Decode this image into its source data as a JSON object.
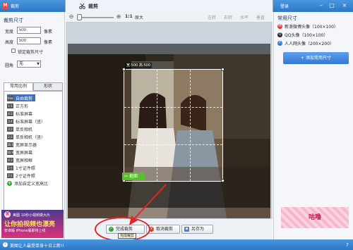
{
  "window": {
    "app_title": "裁剪",
    "tab_title": "裁剪",
    "login": "登录"
  },
  "left": {
    "section_title": "裁剪尺寸",
    "width_label": "宽度",
    "width_value": "500",
    "width_unit": "像素",
    "height_label": "高度",
    "height_value": "500",
    "height_unit": "像素",
    "lock_label": "锁定裁剪尺寸",
    "corner_label": "圆角",
    "corner_value": "无",
    "tab_common": "常用比例",
    "tab_shape": "形状",
    "ratios": [
      "自由裁剪",
      "正方形",
      "标准屏幕",
      "标准屏幕（竖）",
      "单反相机",
      "单反相机（竖）",
      "宽屏显示器",
      "宽屏屏幕",
      "宽屏相框",
      "1寸证件照",
      "2寸证件照",
      "添加自定义宽高比"
    ],
    "ratio_icons": [
      "free",
      "1:1",
      "4:3",
      "3:4",
      "3:2",
      "2:3",
      "16:10",
      "16:9",
      "4:3",
      "1寸",
      "2寸",
      "+"
    ]
  },
  "ad": {
    "line1": "美图 10秒小视频做大片",
    "line2": "让你拍视频也漂亮",
    "line3": "安卓版 iPhone版即将上线"
  },
  "toolbar": {
    "zoom_ratio": "1:1",
    "original": "原大",
    "rotate_left": "左转",
    "rotate_right": "右转",
    "flip_h": "水平",
    "flip_v": "垂直"
  },
  "canvas": {
    "size_label": "宽:500 高:500",
    "cutout_button": "抠图"
  },
  "buttons": {
    "complete": "完成裁剪",
    "cancel": "取消裁剪",
    "save_as": "另存为"
  },
  "tooltip": "完成裁剪",
  "right": {
    "section_title": "常用尺寸",
    "presets": [
      "新浪微博头像（100×100）",
      "QQ头像（100×100）",
      "人人网头像（200×200）"
    ],
    "add_button": "添加常用尺寸",
    "ad_text": "咕噜"
  },
  "status": {
    "text": "美图让人最受单身十日上新!!"
  },
  "colors": {
    "accent": "#2d77c7",
    "selection": "#3f6fb6",
    "highlight_red": "#e2262a",
    "cutout_green": "#58c02c"
  }
}
